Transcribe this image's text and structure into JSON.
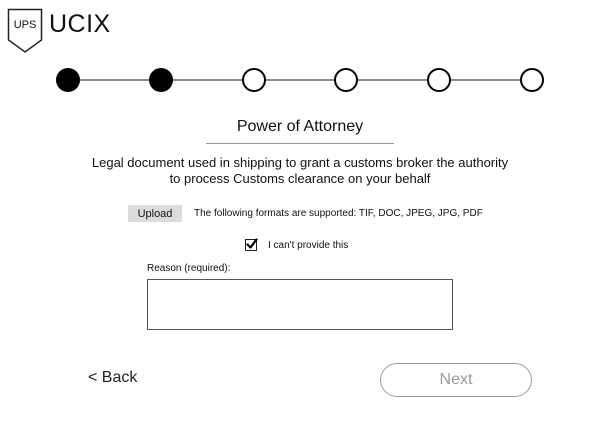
{
  "header": {
    "logo_text": "UPS",
    "brand_name": "UCIX"
  },
  "stepper": {
    "steps": [
      {
        "status": "complete"
      },
      {
        "status": "complete"
      },
      {
        "status": "incomplete"
      },
      {
        "status": "incomplete"
      },
      {
        "status": "incomplete"
      },
      {
        "status": "incomplete"
      }
    ]
  },
  "main": {
    "title": "Power of Attorney",
    "description": "Legal document used in shipping to grant a customs broker the authority to process Customs clearance on your behalf",
    "upload_label": "Upload",
    "formats_text": "The following formats are supported: TIF, DOC, JPEG, JPG, PDF",
    "checkbox_label": "I can't provide this",
    "checkbox_checked": true,
    "reason_label": "Reason (required):",
    "reason_value": ""
  },
  "footer": {
    "back_label": "< Back",
    "next_label": "Next"
  },
  "colors": {
    "step_complete": "#000000",
    "step_incomplete": "#ffffff",
    "connector": "#8a8a8a",
    "next_disabled": "#9a9a9a",
    "upload_bg": "#dcdcdc"
  }
}
